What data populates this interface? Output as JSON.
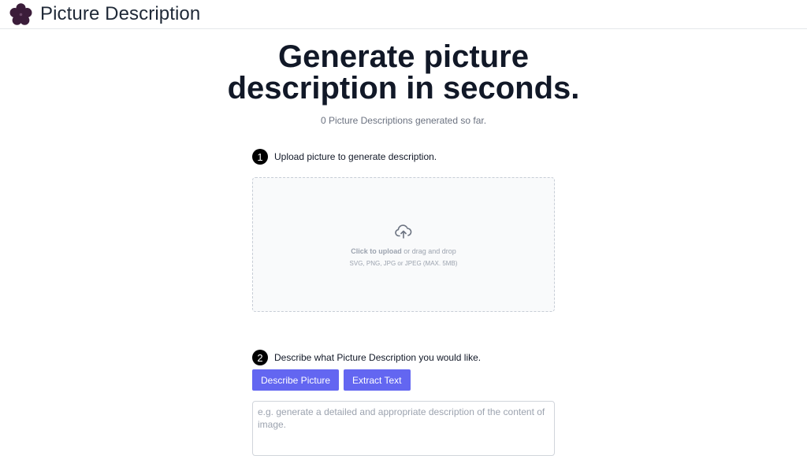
{
  "app": {
    "title": "Picture Description",
    "logo_icon": "flower-logo-icon",
    "brand_color": "#3b1d3a"
  },
  "hero": {
    "title_line1": "Generate picture",
    "title_line2": "description in seconds.",
    "counter_text": "0 Picture Descriptions generated so far."
  },
  "step1": {
    "number": "1",
    "label": "Upload picture to generate description."
  },
  "dropzone": {
    "icon": "cloud-upload-icon",
    "click_text": "Click to upload",
    "drag_text": " or drag and drop",
    "formats_text": "SVG, PNG, JPG or JPEG (MAX. 5MB)"
  },
  "step2": {
    "number": "2",
    "label": "Describe what Picture Description you would like."
  },
  "buttons": {
    "describe_label": "Describe Picture",
    "extract_label": "Extract Text",
    "accent_color": "#6366f1"
  },
  "prompt": {
    "value": "",
    "placeholder": "e.g. generate a detailed and appropriate description of the content of image."
  }
}
